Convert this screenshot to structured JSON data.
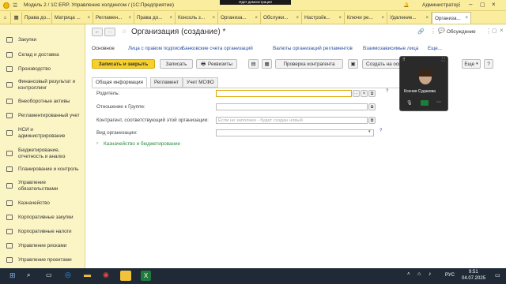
{
  "titlebar": {
    "title": "Модель 2 / 1С:ERP. Управление холдингом / (1С:Предприятие)",
    "banner": "Идет демонстрация",
    "user": "Администратор"
  },
  "tabs": [
    {
      "label": "Права до..."
    },
    {
      "label": "Матрица ..."
    },
    {
      "label": "Регламен..."
    },
    {
      "label": "Права до..."
    },
    {
      "label": "Консоль з..."
    },
    {
      "label": "Организа..."
    },
    {
      "label": "Обслужи..."
    },
    {
      "label": "Настройк..."
    },
    {
      "label": "Ключи ре..."
    },
    {
      "label": "Удаление..."
    },
    {
      "label": "Организа..."
    }
  ],
  "sidebar": {
    "items": [
      {
        "label": "Закупки",
        "icon": "cart-icon"
      },
      {
        "label": "Склад и доставка",
        "icon": "warehouse-icon"
      },
      {
        "label": "Производство",
        "icon": "factory-icon"
      },
      {
        "label": "Финансовый результат и контроллинг",
        "icon": "chart-icon"
      },
      {
        "label": "Внеоборотные активы",
        "icon": "building-icon"
      },
      {
        "label": "Регламентированный учет",
        "icon": "ledger-icon"
      },
      {
        "label": "НСИ и администрирование",
        "icon": "gear-icon"
      },
      {
        "label": "Бюджетирование, отчетность и анализ",
        "icon": "budget-icon"
      },
      {
        "label": "Планирование и контроль",
        "icon": "plan-icon"
      },
      {
        "label": "Управление обязательствами",
        "icon": "obligations-icon"
      },
      {
        "label": "Казначейство",
        "icon": "treasury-icon"
      },
      {
        "label": "Корпоративные закупки",
        "icon": "corporate-purchase-icon"
      },
      {
        "label": "Корпоративные налоги",
        "icon": "tax-icon"
      },
      {
        "label": "Управление рисками",
        "icon": "risk-icon"
      },
      {
        "label": "Управление проектами",
        "icon": "project-icon"
      }
    ]
  },
  "form": {
    "title": "Организация (создание) *",
    "discussion": "Обсуждение",
    "nav_links": [
      {
        "label": "Основное"
      },
      {
        "label": "Лица с правом подписи"
      },
      {
        "label": "Банковские счета организаций"
      },
      {
        "label": "Валюты организаций регламентов"
      },
      {
        "label": "Взаимозависимые лица"
      },
      {
        "label": "Еще..."
      }
    ],
    "toolbar": {
      "save_close": "Записать и закрыть",
      "save": "Записать",
      "requisites": "Реквизиты",
      "check": "Проверка контрагента",
      "create_basis": "Создать на основании",
      "more": "Еще",
      "help": "?"
    },
    "subtabs": [
      {
        "label": "Общая информация"
      },
      {
        "label": "Регламент"
      },
      {
        "label": "Учет МСФО"
      }
    ],
    "fields": [
      {
        "label": "Родитель:",
        "value": "",
        "placeholder": ""
      },
      {
        "label": "Отношение к Группе:",
        "value": "",
        "placeholder": ""
      },
      {
        "label": "Контрагент, соответствующий этой организации:",
        "value": "",
        "placeholder": "Если не заполнен - будет создан новый"
      },
      {
        "label": "Вид организации:",
        "value": "",
        "placeholder": ""
      }
    ],
    "group_link": "Казначейство и бюджетирование"
  },
  "video": {
    "name": "Ксения Судакова"
  },
  "taskbar": {
    "time": "9:51",
    "date": "04.07.2025",
    "lang": "РУС"
  }
}
